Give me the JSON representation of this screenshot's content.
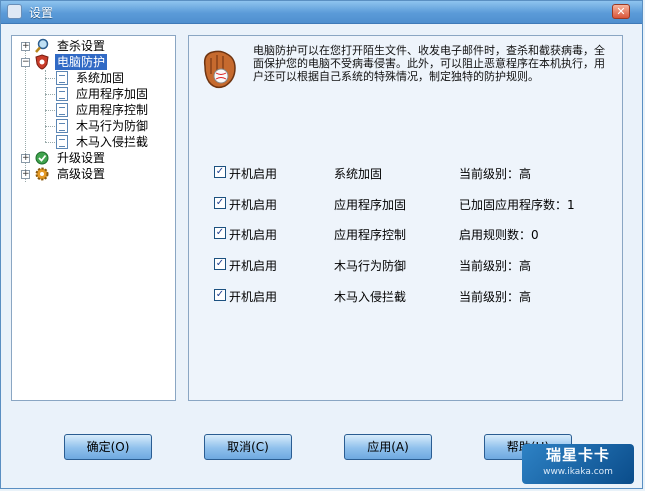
{
  "window": {
    "title": "设置"
  },
  "sidebar": {
    "items": [
      {
        "label": "查杀设置",
        "expander": "+"
      },
      {
        "label": "电脑防护",
        "expander": "−"
      },
      {
        "label": "系统加固"
      },
      {
        "label": "应用程序加固"
      },
      {
        "label": "应用程序控制"
      },
      {
        "label": "木马行为防御"
      },
      {
        "label": "木马入侵拦截"
      },
      {
        "label": "升级设置",
        "expander": "+"
      },
      {
        "label": "高级设置",
        "expander": "+"
      }
    ]
  },
  "content": {
    "description": "电脑防护可以在您打开陌生文件、收发电子邮件时，查杀和截获病毒，全面保护您的电脑不受病毒侵害。此外，可以阻止恶意程序在本机执行，用户还可以根据自己系统的特殊情况，制定独特的防护规则。",
    "features": [
      {
        "checkbox_label": "开机启用",
        "name": "系统加固",
        "status": "当前级别：高",
        "checked": true
      },
      {
        "checkbox_label": "开机启用",
        "name": "应用程序加固",
        "status": "已加固应用程序数：1",
        "checked": true
      },
      {
        "checkbox_label": "开机启用",
        "name": "应用程序控制",
        "status": "启用规则数：0",
        "checked": true
      },
      {
        "checkbox_label": "开机启用",
        "name": "木马行为防御",
        "status": "当前级别：高",
        "checked": true
      },
      {
        "checkbox_label": "开机启用",
        "name": "木马入侵拦截",
        "status": "当前级别：高",
        "checked": true
      }
    ]
  },
  "buttons": {
    "ok": "确定(O)",
    "cancel": "取消(C)",
    "apply": "应用(A)",
    "help": "帮助(H)"
  },
  "watermark": {
    "logo": "瑞星卡卡",
    "url": "www.ikaka.com"
  },
  "colors": {
    "title_bar": "#5b9bd8",
    "selected": "#316ac5",
    "button": "#8fc0ec"
  }
}
